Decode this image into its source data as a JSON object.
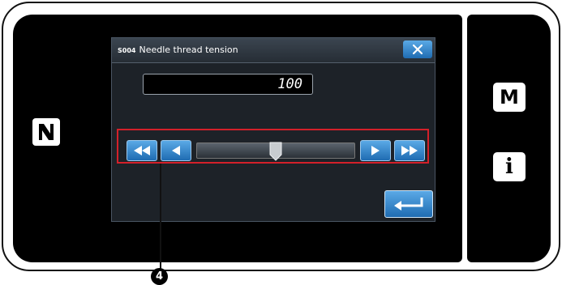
{
  "dialog": {
    "code": "S004",
    "title": "Needle thread tension"
  },
  "value_field": {
    "value": "100"
  },
  "slider": {
    "level": 0.5
  },
  "side_panel": {
    "m_label": "M",
    "info_label": "i"
  },
  "callout": {
    "marker": "4"
  },
  "colors": {
    "button_blue": "#1f6cb2",
    "callout_red": "#d3202a"
  },
  "icons": {
    "nfc": "nfc-icon",
    "close": "close-icon",
    "fast_left": "double-left-arrow-icon",
    "left": "left-arrow-icon",
    "right": "right-arrow-icon",
    "fast_right": "double-right-arrow-icon",
    "enter": "enter-icon"
  }
}
